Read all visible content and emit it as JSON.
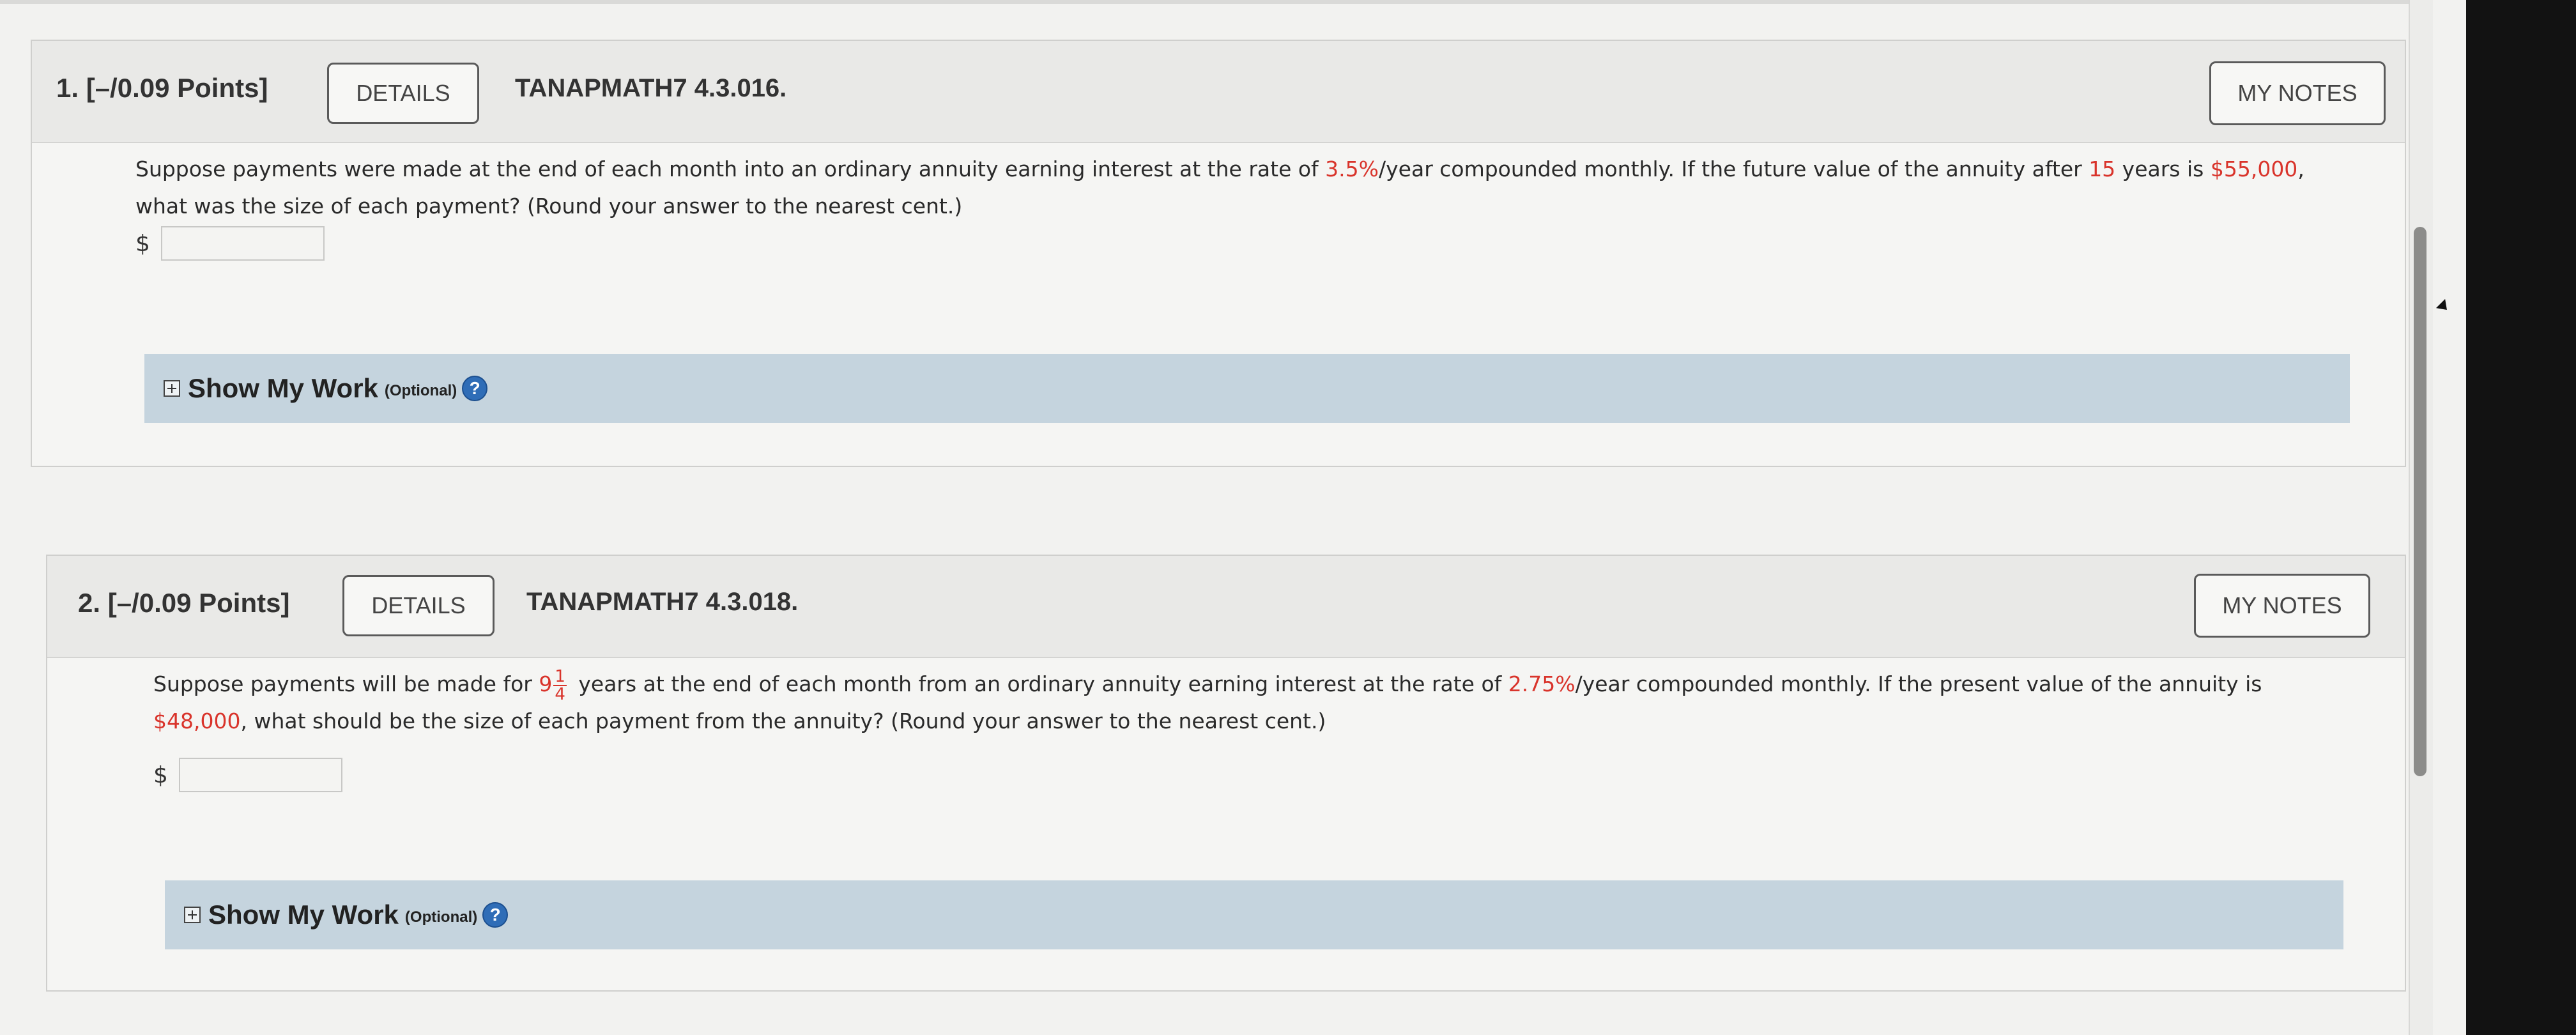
{
  "questions": [
    {
      "number": "1.",
      "points": "[–/0.09 Points]",
      "details_label": "DETAILS",
      "code": "TANAPMATH7 4.3.016.",
      "notes_label": "MY NOTES",
      "text_parts": {
        "p1": "Suppose payments were made at the end of each month into an ordinary annuity earning interest at the rate of ",
        "rate": "3.5%",
        "p2": "/year compounded monthly. If the future value of the annuity after ",
        "years": "15",
        "p3": " years is ",
        "amount": "$55,000",
        "p4": ", what was the size of each payment? (Round your answer to the nearest cent.)"
      },
      "currency": "$",
      "answer_value": "",
      "show_work": "Show My Work",
      "optional": "(Optional)",
      "help": "?"
    },
    {
      "number": "2.",
      "points": "[–/0.09 Points]",
      "details_label": "DETAILS",
      "code": "TANAPMATH7 4.3.018.",
      "notes_label": "MY NOTES",
      "text_parts": {
        "p1": "Suppose payments will be made for ",
        "whole": "9",
        "frac_num": "1",
        "frac_den": "4",
        "p2": " years at the end of each month from an ordinary annuity earning interest at the rate of ",
        "rate": "2.75%",
        "p3": "/year compounded monthly. If the present value of the annuity is ",
        "amount": "$48,000",
        "p4": ", what should be the size of each payment from the annuity? (Round your answer to the nearest cent.)"
      },
      "currency": "$",
      "answer_value": "",
      "show_work": "Show My Work",
      "optional": "(Optional)",
      "help": "?"
    }
  ],
  "colors": {
    "highlight": "#d9342b",
    "work_bar": "#c5d4de",
    "help_icon": "#2f6db7"
  },
  "icons": [
    "expand-plus-icon",
    "help-icon"
  ]
}
